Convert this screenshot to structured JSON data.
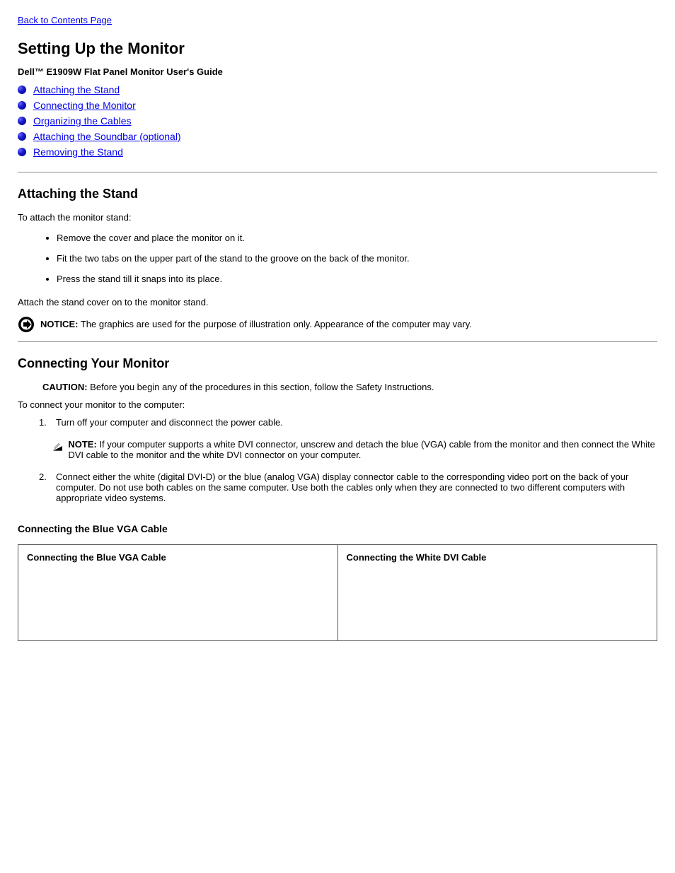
{
  "back_link": "Back to Contents Page",
  "page_title": "Setting Up the Monitor",
  "subtitle": "Dell™ E1909W Flat Panel Monitor User's Guide",
  "toc": [
    {
      "label": "Attaching the Stand"
    },
    {
      "label": "Connecting the Monitor"
    },
    {
      "label": "Organizing the Cables"
    },
    {
      "label": "Attaching the Soundbar (optional)"
    },
    {
      "label": "Removing the Stand"
    }
  ],
  "section1": {
    "heading": "Attaching the Stand",
    "intro": "To attach the monitor stand:",
    "steps": [
      "Remove the cover and place the monitor on it.",
      "Fit the two tabs on the upper part of the stand to the groove on the back of the monitor.",
      "Press the stand till it snaps into its place."
    ],
    "closing": "Attach the stand cover on to the monitor stand.",
    "notice_label": "NOTICE:",
    "notice_text": "The graphics are used for the purpose of illustration only. Appearance of the computer may vary."
  },
  "section2": {
    "heading": "Connecting Your Monitor",
    "caution_label": "CAUTION:",
    "caution_text": "Before you begin any of the procedures in this section, follow the Safety Instructions.",
    "intro": "To connect your monitor to the computer:",
    "step1_num": "1.",
    "step1_text": "Turn off your computer and disconnect the power cable.",
    "note_label": "NOTE:",
    "note_text": "If your computer supports a white DVI connector, unscrew and detach the blue (VGA) cable from the monitor and then connect the White DVI cable to the monitor and the white DVI connector on your computer.",
    "step2_num": "2.",
    "step2_text": "Connect either the white (digital DVI-D) or the blue (analog VGA) display connector cable to the corresponding video port on the back of your computer. Do not use both cables on the same computer. Use both the cables only when they are connected to two different computers with appropriate video systems.",
    "sub_title": "Connecting the Blue VGA Cable",
    "table_headers": [
      "Connecting the Blue VGA Cable",
      "Connecting the White DVI Cable"
    ]
  }
}
